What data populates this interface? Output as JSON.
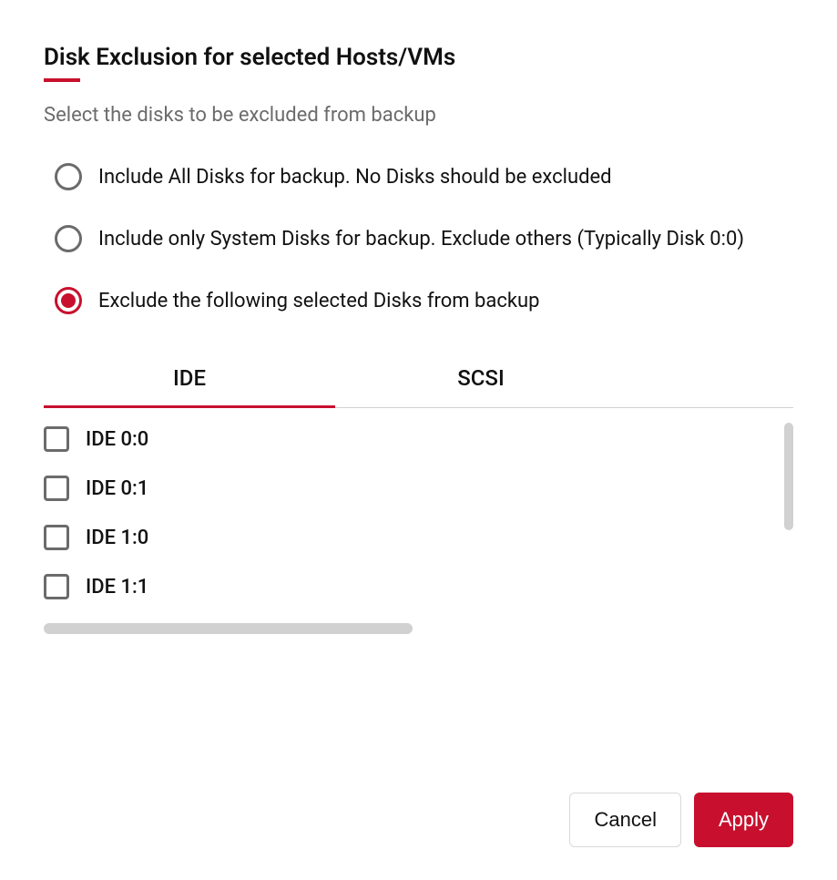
{
  "header": {
    "title": "Disk Exclusion for selected Hosts/VMs",
    "subtitle": "Select the disks to be excluded from backup"
  },
  "options": {
    "selected_index": 2,
    "items": [
      {
        "label": "Include All Disks for backup. No Disks should be excluded"
      },
      {
        "label": "Include only System Disks for backup. Exclude others (Typically Disk 0:0)"
      },
      {
        "label": "Exclude the following selected Disks from backup"
      }
    ]
  },
  "tabs": {
    "active_index": 0,
    "items": [
      {
        "label": "IDE"
      },
      {
        "label": "SCSI"
      }
    ]
  },
  "disks": [
    {
      "label": "IDE 0:0",
      "checked": false
    },
    {
      "label": "IDE 0:1",
      "checked": false
    },
    {
      "label": "IDE 1:0",
      "checked": false
    },
    {
      "label": "IDE 1:1",
      "checked": false
    }
  ],
  "footer": {
    "cancel": "Cancel",
    "apply": "Apply"
  }
}
